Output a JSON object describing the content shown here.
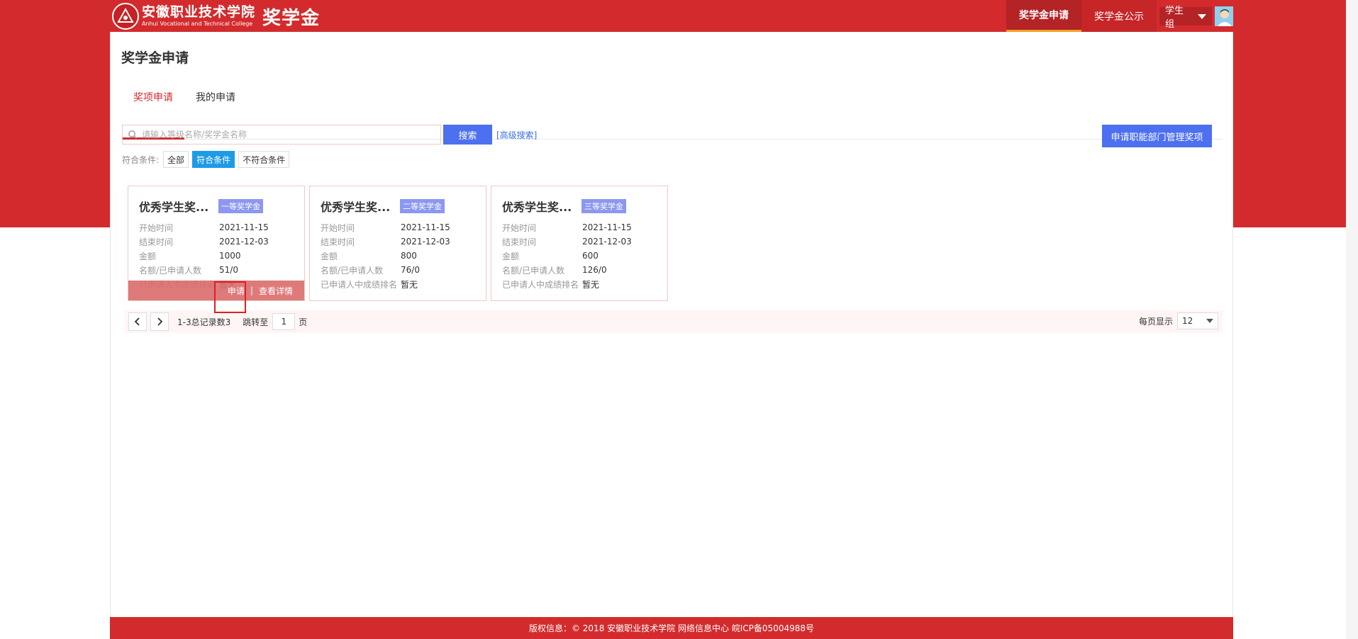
{
  "header": {
    "logo_cn": "安徽职业技术学院",
    "logo_en": "Anhui Vocational and Technical College",
    "app_title": "奖学金",
    "nav": [
      {
        "label": "奖学金申请",
        "active": true
      },
      {
        "label": "奖学金公示",
        "active": false
      }
    ],
    "user_role": "学生组"
  },
  "page": {
    "title": "奖学金申请",
    "tabs": [
      {
        "label": "奖项申请",
        "active": true
      },
      {
        "label": "我的申请",
        "active": false
      }
    ]
  },
  "search": {
    "placeholder": "请输入等级名称/奖学金名称",
    "value": "",
    "button_label": "搜索",
    "advanced_label": "[高级搜索]"
  },
  "manage_button_label": "申请职能部门管理奖项",
  "filter": {
    "label": "符合条件:",
    "options": [
      {
        "label": "全部",
        "active": false
      },
      {
        "label": "符合条件",
        "active": true
      },
      {
        "label": "不符合条件",
        "active": false
      }
    ]
  },
  "cards": [
    {
      "title": "优秀学生奖...",
      "badge": "一等奖学金",
      "fields": [
        {
          "key": "开始时间",
          "value": "2021-11-15"
        },
        {
          "key": "结束时间",
          "value": "2021-12-03"
        },
        {
          "key": "金额",
          "value": "1000"
        },
        {
          "key": "名额/已申请人数",
          "value": "51/0"
        },
        {
          "key": "已申请人中成绩排名",
          "value": "暂无"
        }
      ],
      "actions": {
        "apply": "申请",
        "separator": "|",
        "details": "查看详情"
      },
      "hovered": true
    },
    {
      "title": "优秀学生奖...",
      "badge": "二等奖学金",
      "fields": [
        {
          "key": "开始时间",
          "value": "2021-11-15"
        },
        {
          "key": "结束时间",
          "value": "2021-12-03"
        },
        {
          "key": "金额",
          "value": "800"
        },
        {
          "key": "名额/已申请人数",
          "value": "76/0"
        },
        {
          "key": "已申请人中成绩排名",
          "value": "暂无"
        }
      ],
      "hovered": false
    },
    {
      "title": "优秀学生奖...",
      "badge": "三等奖学金",
      "fields": [
        {
          "key": "开始时间",
          "value": "2021-11-15"
        },
        {
          "key": "结束时间",
          "value": "2021-12-03"
        },
        {
          "key": "金额",
          "value": "600"
        },
        {
          "key": "名额/已申请人数",
          "value": "126/0"
        },
        {
          "key": "已申请人中成绩排名",
          "value": "暂无"
        }
      ],
      "hovered": false
    }
  ],
  "pagination": {
    "info": "1-3总记录数3",
    "jump_label": "跳转至",
    "page_value": "1",
    "page_unit": "页",
    "per_page_label": "每页显示",
    "per_page_value": "12"
  },
  "footer": {
    "text": "版权信息：© 2018 安徽职业技术学院 网络信息中心 皖ICP备05004988号"
  },
  "colors": {
    "brand_red": "#d32b2d",
    "primary_blue": "#4c70f0",
    "filter_active": "#1e9be6",
    "nav_underline": "#f0a023",
    "badge": "#8b97f0"
  }
}
